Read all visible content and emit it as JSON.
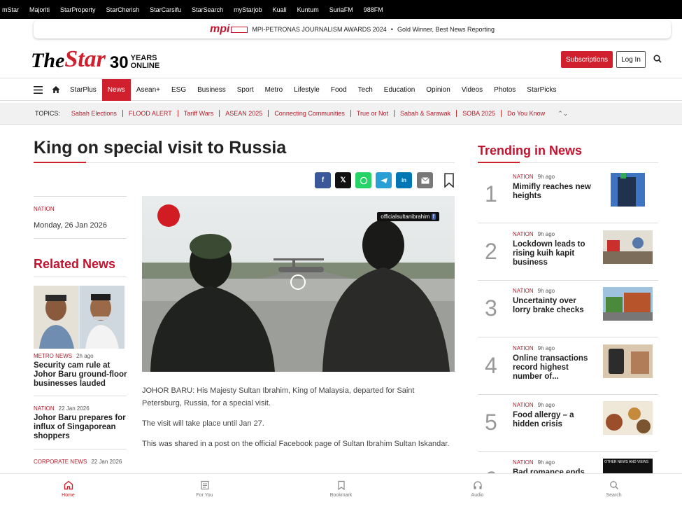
{
  "topbar": [
    "mStar",
    "Majoriti",
    "StarProperty",
    "StarCherish",
    "StarCarsifu",
    "StarSearch",
    "myStarjob",
    "Kuali",
    "Kuntum",
    "SuriaFM",
    "988FM"
  ],
  "awards": {
    "logo": "mpi",
    "title": "MPI-PETRONAS JOURNALISM AWARDS 2024",
    "sep": "•",
    "award": "Gold Winner, Best News Reporting"
  },
  "header": {
    "logo_the": "The",
    "logo_star": "Star",
    "logo_30": "30",
    "logo_years": "YEARS",
    "logo_online": "ONLINE",
    "subscribe": "Subscriptions",
    "login": "Log In"
  },
  "nav": [
    "StarPlus",
    "News",
    "Asean+",
    "ESG",
    "Business",
    "Sport",
    "Metro",
    "Lifestyle",
    "Food",
    "Tech",
    "Education",
    "Opinion",
    "Videos",
    "Photos",
    "StarPicks"
  ],
  "nav_active": "News",
  "topics": {
    "label": "TOPICS:",
    "items": [
      "Sabah Elections",
      "FLOOD ALERT",
      "Tariff Wars",
      "ASEAN 2025",
      "Connecting Communities",
      "True or Not",
      "Sabah & Sarawak",
      "SOBA 2025",
      "Do You Know"
    ]
  },
  "article": {
    "title": "King on special visit to Russia",
    "category": "NATION",
    "date": "Monday, 26 Jan 2026",
    "image_tag": "officialsultanibrahim",
    "paragraphs": [
      "JOHOR BARU: His Majesty Sultan Ibrahim, King of Malaysia, departed for Saint Petersburg, Russia, for a special visit.",
      "The visit will take place until Jan 27.",
      "This was shared in a post on the official Facebook page of Sultan Ibrahim Sultan Iskandar."
    ]
  },
  "share_icons": [
    "facebook-icon",
    "x-icon",
    "whatsapp-icon",
    "telegram-icon",
    "linkedin-icon",
    "email-icon"
  ],
  "colors": {
    "brand": "#d0202e",
    "facebook": "#3b5998",
    "x": "#111111",
    "whatsapp": "#25d366",
    "telegram": "#2a9fd6",
    "linkedin": "#0077b5",
    "email": "#777777"
  },
  "related": {
    "heading": "Related News",
    "items": [
      {
        "cat": "METRO NEWS",
        "time": "2h ago",
        "title": "Security cam rule at Johor Baru ground-floor businesses lauded"
      },
      {
        "cat": "NATION",
        "time": "22 Jan 2026",
        "title": "Johor Baru prepares for influx of Singaporean shoppers"
      },
      {
        "cat": "CORPORATE NEWS",
        "time": "22 Jan 2026",
        "title": ""
      }
    ]
  },
  "trending": {
    "heading": "Trending in News",
    "items": [
      {
        "num": "1",
        "cat": "NATION",
        "time": "9h ago",
        "title": "Mimifly reaches new heights"
      },
      {
        "num": "2",
        "cat": "NATION",
        "time": "9h ago",
        "title": "Lockdown leads to rising kuih kapit business"
      },
      {
        "num": "3",
        "cat": "NATION",
        "time": "9h ago",
        "title": "Uncertainty over lorry brake checks"
      },
      {
        "num": "4",
        "cat": "NATION",
        "time": "9h ago",
        "title": "Online transactions record highest number of..."
      },
      {
        "num": "5",
        "cat": "NATION",
        "time": "9h ago",
        "title": "Food allergy – a hidden crisis"
      },
      {
        "num": "6",
        "cat": "NATION",
        "time": "9h ago",
        "title": "Bad romance ends..."
      }
    ]
  },
  "trending_img6_text": "OTHER NEWS AND VIEWS",
  "bottom_nav": [
    "Home",
    "For You",
    "Bookmark",
    "Audio",
    "Search"
  ]
}
